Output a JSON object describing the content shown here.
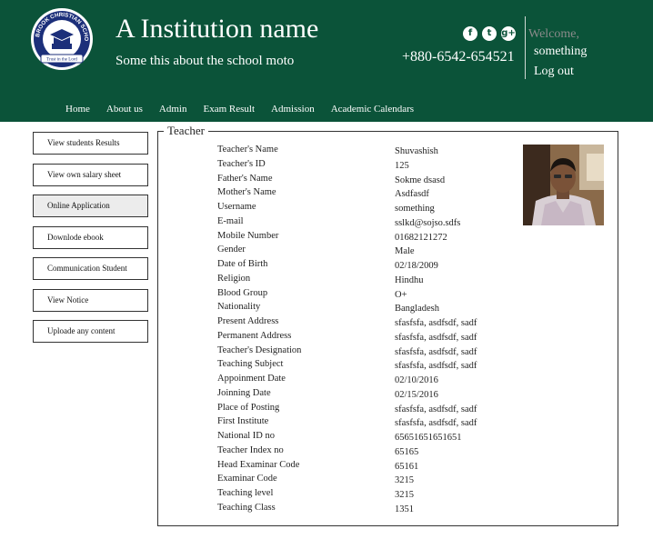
{
  "header": {
    "logo_text": "SEABROOK CHRISTIAN SCHOOL",
    "logo_banner": "Trust in the Lord",
    "institution_name": "A Institution name",
    "moto": "Some this about the school moto",
    "phone": "+880-6542-654521",
    "welcome": "Welcome,",
    "username": "something",
    "logout": "Log out",
    "social_icons": [
      "facebook-icon",
      "twitter-icon",
      "google-plus-icon"
    ]
  },
  "nav": {
    "items": [
      "Home",
      "About us",
      "Admin",
      "Exam Result",
      "Admission",
      "Academic Calendars"
    ]
  },
  "sidebar": {
    "items": [
      "View students Results",
      "View own salary sheet",
      "Online Application",
      "Downlode ebook",
      "Communication Student",
      "View Notice",
      "Uploade any content"
    ],
    "active_index": 2
  },
  "panel": {
    "legend": "Teacher",
    "fields": [
      {
        "label": "Teacher's Name",
        "value": "Shuvashish"
      },
      {
        "label": "Teacher's ID",
        "value": "125"
      },
      {
        "label": "Father's Name",
        "value": "Sokme dsasd"
      },
      {
        "label": "Mother's Name",
        "value": "Asdfasdf"
      },
      {
        "label": "Username",
        "value": "something"
      },
      {
        "label": "E-mail",
        "value": "sslkd@sojso.sdfs"
      },
      {
        "label": "Mobile Number",
        "value": "01682121272"
      },
      {
        "label": "Gender",
        "value": "Male"
      },
      {
        "label": "Date of Birth",
        "value": "02/18/2009"
      },
      {
        "label": "Religion",
        "value": "Hindhu"
      },
      {
        "label": "Blood Group",
        "value": "O+"
      },
      {
        "label": "Nationality",
        "value": "Bangladesh"
      },
      {
        "label": "Present Address",
        "value": "sfasfsfa, asdfsdf, sadf"
      },
      {
        "label": "Permanent Address",
        "value": "sfasfsfa, asdfsdf, sadf"
      },
      {
        "label": "Teacher's Designation",
        "value": "sfasfsfa, asdfsdf, sadf"
      },
      {
        "label": "Teaching Subject",
        "value": "sfasfsfa, asdfsdf, sadf"
      },
      {
        "label": "Appoinment Date",
        "value": "02/10/2016"
      },
      {
        "label": "Joinning Date",
        "value": "02/15/2016"
      },
      {
        "label": "Place of Posting",
        "value": "sfasfsfa, asdfsdf, sadf"
      },
      {
        "label": "First Institute",
        "value": "sfasfsfa, asdfsdf, sadf"
      },
      {
        "label": "National ID no",
        "value": "65651651651651"
      },
      {
        "label": "Teacher Index no",
        "value": "65165"
      },
      {
        "label": "Head Examinar Code",
        "value": "65161"
      },
      {
        "label": "Examinar Code",
        "value": "3215"
      },
      {
        "label": "Teaching level",
        "value": "3215"
      },
      {
        "label": "Teaching Class",
        "value": "1351"
      }
    ]
  },
  "colors": {
    "header_bg": "#0b5339",
    "active_sidebar_bg": "#ececec"
  }
}
